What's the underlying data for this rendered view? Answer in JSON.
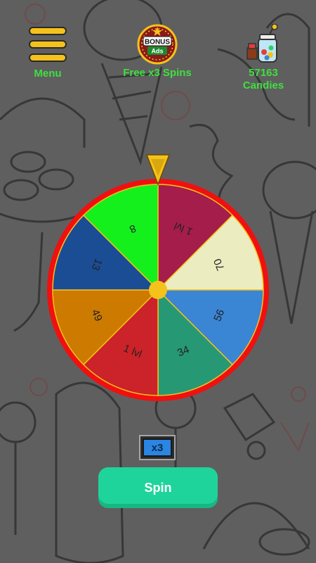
{
  "header": {
    "menu_label": "Menu",
    "bonus_label": "Free x3 Spins",
    "bonus_badge_top": "BONUS",
    "bonus_badge_bottom": "Ads",
    "candies_count": "57163",
    "candies_label": "Candies"
  },
  "wheel": {
    "segments": [
      {
        "label": "1 lvl",
        "color": "#a41d4b"
      },
      {
        "label": "70",
        "color": "#ececc1"
      },
      {
        "label": "56",
        "color": "#3a85d4"
      },
      {
        "label": "34",
        "color": "#279874"
      },
      {
        "label": "1 lvl",
        "color": "#cc2229"
      },
      {
        "label": "49",
        "color": "#cc7a00"
      },
      {
        "label": "13",
        "color": "#1b4d95"
      },
      {
        "label": "8",
        "color": "#14f01c"
      }
    ],
    "rim_color": "#f01010",
    "hub_color": "#f5c21b",
    "pointer_color": "#f5c21b"
  },
  "controls": {
    "multiplier": "x3",
    "spin_label": "Spin"
  }
}
